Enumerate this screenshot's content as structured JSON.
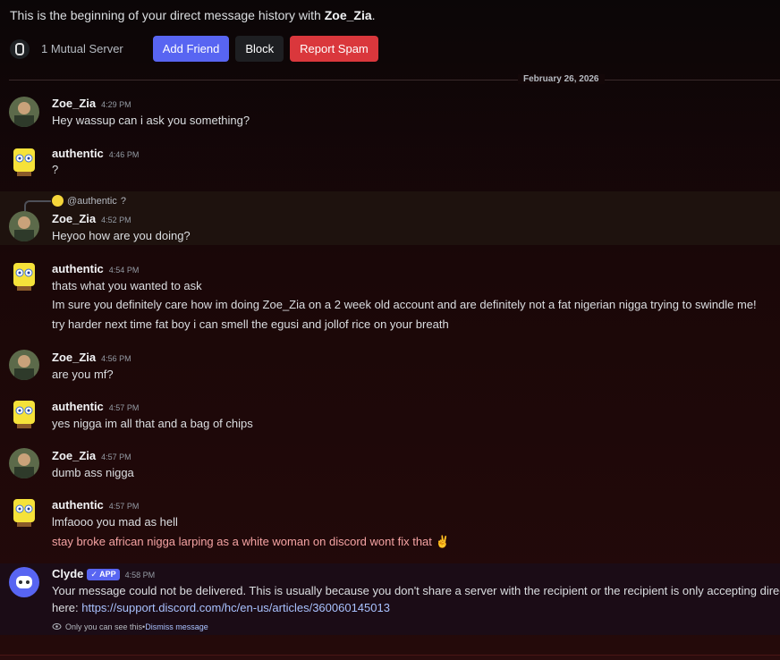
{
  "intro": {
    "prefix": "This is the beginning of your direct message history with ",
    "username": "Zoe_Zia",
    "suffix": "."
  },
  "actions": {
    "mutual_servers": "1 Mutual Server",
    "add_friend": "Add Friend",
    "block": "Block",
    "report_spam": "Report Spam"
  },
  "date_divider": "February 26, 2026",
  "messages": [
    {
      "author": "Zoe_Zia",
      "time": "4:29 PM",
      "lines": [
        "Hey wassup can i ask you something?"
      ]
    },
    {
      "author": "authentic",
      "time": "4:46 PM",
      "lines": [
        "?"
      ]
    },
    {
      "reply_to": "@authentic",
      "reply_text": "?",
      "author": "Zoe_Zia",
      "time": "4:52 PM",
      "lines": [
        "Heyoo how are you doing?"
      ]
    },
    {
      "author": "authentic",
      "time": "4:54 PM",
      "lines": [
        "thats what you wanted to ask",
        "Im sure you definitely care how im doing Zoe_Zia on a 2 week old account and are definitely not a fat nigerian nigga trying to swindle me!",
        "try harder next time fat boy i can smell the egusi and jollof rice on your breath"
      ]
    },
    {
      "author": "Zoe_Zia",
      "time": "4:56 PM",
      "lines": [
        "are you mf?"
      ]
    },
    {
      "author": "authentic",
      "time": "4:57 PM",
      "lines": [
        "yes nigga im all that and a bag of chips"
      ]
    },
    {
      "author": "Zoe_Zia",
      "time": "4:57 PM",
      "lines": [
        "dumb ass nigga"
      ]
    },
    {
      "author": "authentic",
      "time": "4:57 PM",
      "lines": [
        "lmfaooo you mad as hell",
        "stay broke african nigga larping as a white woman on discord wont fix that ✌️"
      ]
    }
  ],
  "clyde": {
    "author": "Clyde",
    "badge": "✓ APP",
    "time": "4:58 PM",
    "text": "Your message could not be delivered. This is usually because you don't share a server with the recipient or the recipient is only accepting direct",
    "text2_prefix": "here: ",
    "link": "https://support.discord.com/hc/en-us/articles/360060145013",
    "note": "Only you can see this",
    "note_sep": " • ",
    "dismiss": "Dismiss message"
  },
  "colors": {
    "accent": "#5865f2",
    "danger": "#da373c",
    "link": "#a9c2ff"
  }
}
